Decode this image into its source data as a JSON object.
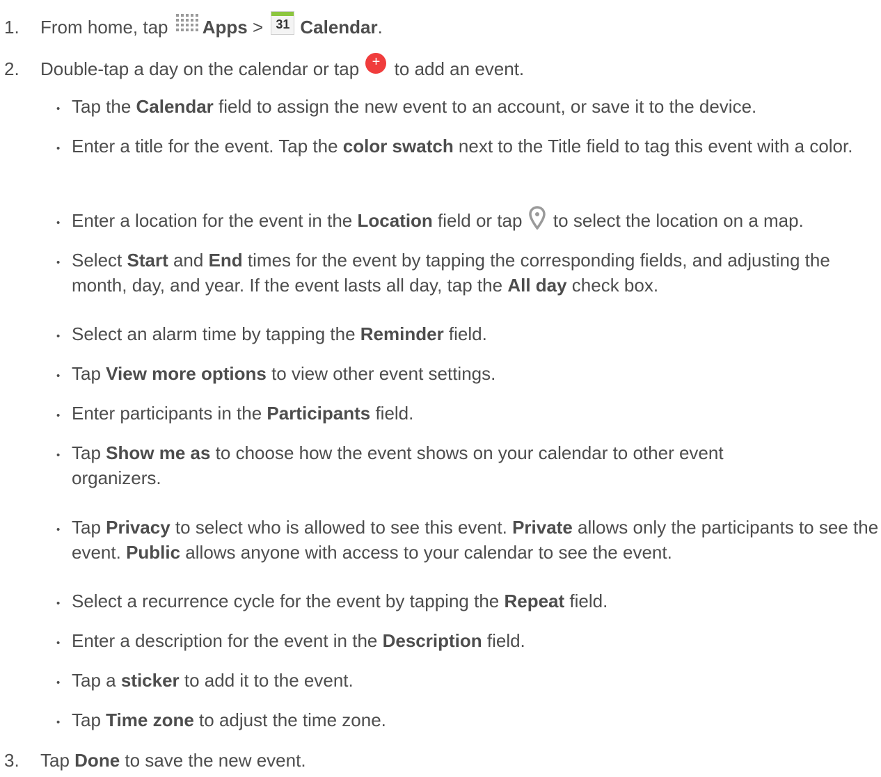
{
  "steps": {
    "s1": {
      "num": "1.",
      "pre": "From home, tap ",
      "apps": "Apps",
      "sep": " > ",
      "cal_digits": "31",
      "calendar": "Calendar",
      "end": "."
    },
    "s2": {
      "num": "2.",
      "pre": "Double-tap a day on the calendar or tap ",
      "post": " to add an event."
    },
    "s3": {
      "num": "3.",
      "pre": "Tap ",
      "done": "Done",
      "post": " to save the new event."
    }
  },
  "bullets": {
    "b1": {
      "a": "Tap the ",
      "b1": "Calendar",
      "c": " field to assign the new event to an account, or save it to the device."
    },
    "b2": {
      "a": "Enter a title for the event. Tap the ",
      "b1": "color swatch",
      "c": " next to the Title field to tag this event with a color."
    },
    "b3": {
      "a": "Enter a location for the event in the ",
      "b1": "Location",
      "c": " field or tap ",
      "d": " to select the location on a map."
    },
    "b4": {
      "a": "Select ",
      "b1": "Start",
      "c": " and ",
      "b2": "End",
      "d": " times for the event by tapping the corresponding fields, and adjusting the month, day, and year. If the event lasts all day, tap the ",
      "b3": "All day",
      "e": " check box."
    },
    "b5": {
      "a": "Select an alarm time by tapping the ",
      "b1": "Reminder",
      "c": " field."
    },
    "b6": {
      "a": "Tap ",
      "b1": "View more options",
      "c": " to view other event settings."
    },
    "b7": {
      "a": "Enter participants in the ",
      "b1": "Participants",
      "c": " field."
    },
    "b8": {
      "a": "Tap ",
      "b1": "Show me as",
      "c": " to choose how the event shows on your calendar to other event organizers."
    },
    "b9": {
      "a": "Tap ",
      "b1": "Privacy",
      "c": " to select who is allowed to see this event. ",
      "b2": "Private",
      "d": " allows only the participants to see the event. ",
      "b3": "Public",
      "e": " allows anyone with access to your calendar to see the event."
    },
    "b10": {
      "a": "Select a recurrence cycle for the event by tapping the ",
      "b1": "Repeat",
      "c": " field."
    },
    "b11": {
      "a": "Enter a description for the event in the ",
      "b1": "Description",
      "c": " field."
    },
    "b12": {
      "a": "Tap a ",
      "b1": "sticker",
      "c": " to add it to the event."
    },
    "b13": {
      "a": "Tap ",
      "b1": "Time zone",
      "c": " to adjust the time zone."
    }
  },
  "bullet_char": "•",
  "colors": {
    "text": "#4d4d4d",
    "calendar_green": "#8cc63f",
    "add_red": "#f03c3c",
    "pin_gray": "#9a9a9a"
  },
  "icons": {
    "apps": "apps-grid-icon",
    "calendar": "calendar-icon",
    "add": "add-event-icon",
    "location": "location-pin-icon"
  }
}
